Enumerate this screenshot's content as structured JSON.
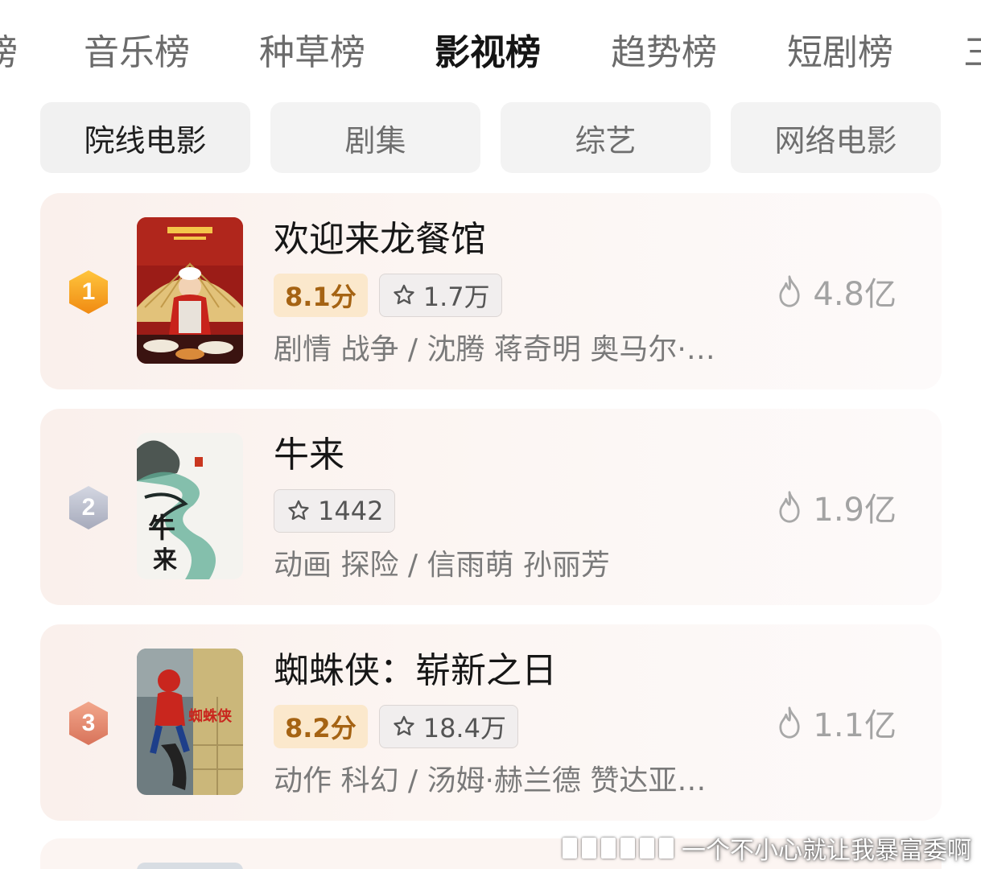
{
  "top_tabs": [
    "榜",
    "音乐榜",
    "种草榜",
    "影视榜",
    "趋势榜",
    "短剧榜",
    "三"
  ],
  "active_top_tab": "影视榜",
  "sub_tabs": [
    "院线电影",
    "剧集",
    "综艺",
    "网络电影"
  ],
  "active_sub_tab": "院线电影",
  "movies": [
    {
      "rank": "1",
      "title": "欢迎来龙餐馆",
      "score": "8.1分",
      "wish": "1.7万",
      "meta": "剧情 战争 / 沈腾 蒋奇明 奥马尔·…",
      "heat": "4.8亿",
      "rank_color": "#f5a623",
      "poster_icon": "chef-poster-image"
    },
    {
      "rank": "2",
      "title": "牛来",
      "score": "",
      "wish": "1442",
      "meta": "动画 探险 / 信雨萌 孙丽芳",
      "heat": "1.9亿",
      "rank_color": "#b8bccb",
      "poster_icon": "ink-landscape-poster-image"
    },
    {
      "rank": "3",
      "title": "蜘蛛侠：崭新之日",
      "score": "8.2分",
      "wish": "18.4万",
      "meta": "动作 科幻 / 汤姆·赫兰德 赞达亚…",
      "heat": "1.1亿",
      "rank_color": "#e08a6e",
      "poster_icon": "spiderman-poster-image"
    }
  ],
  "watermark": "一个不小心就让我暴富委啊",
  "colors": {
    "score_bg": "#fbe8cc",
    "score_text": "#a56313",
    "card_bg": "#faf0ec",
    "heat_text": "#a3a3a3"
  }
}
